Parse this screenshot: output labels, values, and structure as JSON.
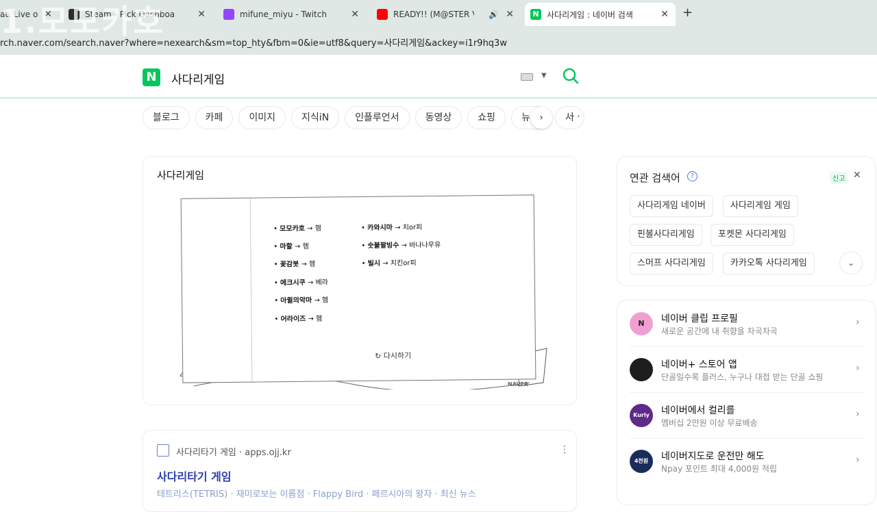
{
  "browser": {
    "tabs": [
      {
        "title": "at. Live o",
        "fav_color": "#888"
      },
      {
        "title": "Steam - Pick Dashboard",
        "fav_color": "#2b2b2b"
      },
      {
        "title": "mifune_miyu - Twitch",
        "fav_color": "#9146ff"
      },
      {
        "title": "READY!! (M@STER Version",
        "fav_color": "#ff0000"
      },
      {
        "title": "사다리게임 : 네이버 검색",
        "fav_color": "#03c75a"
      }
    ],
    "new_tab": "+",
    "url": "rch.naver.com/search.naver?where=nexearch&sm=top_hty&fbm=0&ie=utf8&query=사다리게임&ackey=i1r9hq3w",
    "overlay": "1.모모카호"
  },
  "header": {
    "logo": "N",
    "query": "사다리게임"
  },
  "categories": [
    "블로그",
    "카페",
    "이미지",
    "지식iN",
    "인플루언서",
    "동영상",
    "쇼핑",
    "뉴스",
    "서"
  ],
  "game_card": {
    "title": "사다리게임",
    "left_items": [
      {
        "name": "모모카호",
        "result": "헴"
      },
      {
        "name": "마할",
        "result": "헴"
      },
      {
        "name": "꽃감봇",
        "result": "헴"
      },
      {
        "name": "에크시쿠",
        "result": "베라"
      },
      {
        "name": "아퀼의악마",
        "result": "헴"
      },
      {
        "name": "어라이즈",
        "result": "헴"
      }
    ],
    "right_items": [
      {
        "name": "카와시마",
        "result": "치or피"
      },
      {
        "name": "숫불팔빙수",
        "result": "바나나우유"
      },
      {
        "name": "빌시",
        "result": "치킨or피"
      }
    ],
    "retry": "다시하기",
    "brand": "NAVER"
  },
  "result_card": {
    "site": "사다리타기 게임 · apps.ojj.kr",
    "title": "사다리타기 게임",
    "desc": "테트리스(TETRIS) · 재미로보는 이름점 · Flappy Bird · 페르시아의 왕자 · 최신 뉴스"
  },
  "related": {
    "title": "연관 검색어",
    "help": "?",
    "report": "신고",
    "close": "✕",
    "chips": [
      "사다리게임 네이버",
      "사다리게임 게임",
      "핀볼사다리게임",
      "포켓몬 사다리게임",
      "스머프 사다리게임",
      "카카오톡 사다리게임"
    ]
  },
  "promos": [
    {
      "title": "네이버 클립 프로필",
      "sub": "새로운 공간에 내 취향을 차곡차곡",
      "icon": "N",
      "color": "#f0a0d0"
    },
    {
      "title": "네이버+ 스토어 앱",
      "sub": "단골일수록 플러스, 누구나 대접 받는 단골 쇼핑",
      "icon": "",
      "color": "#1e1e1e"
    },
    {
      "title": "네이버에서 컬리를",
      "sub": "멤버십 2만원 이상 무료배송",
      "icon": "Kurly",
      "color": "#5f2a8a"
    },
    {
      "title": "네이버지도로 운전만 해도",
      "sub": "Npay 포인트 최대 4,000원 적립",
      "icon": "4천원",
      "color": "#1a2d5a"
    }
  ]
}
